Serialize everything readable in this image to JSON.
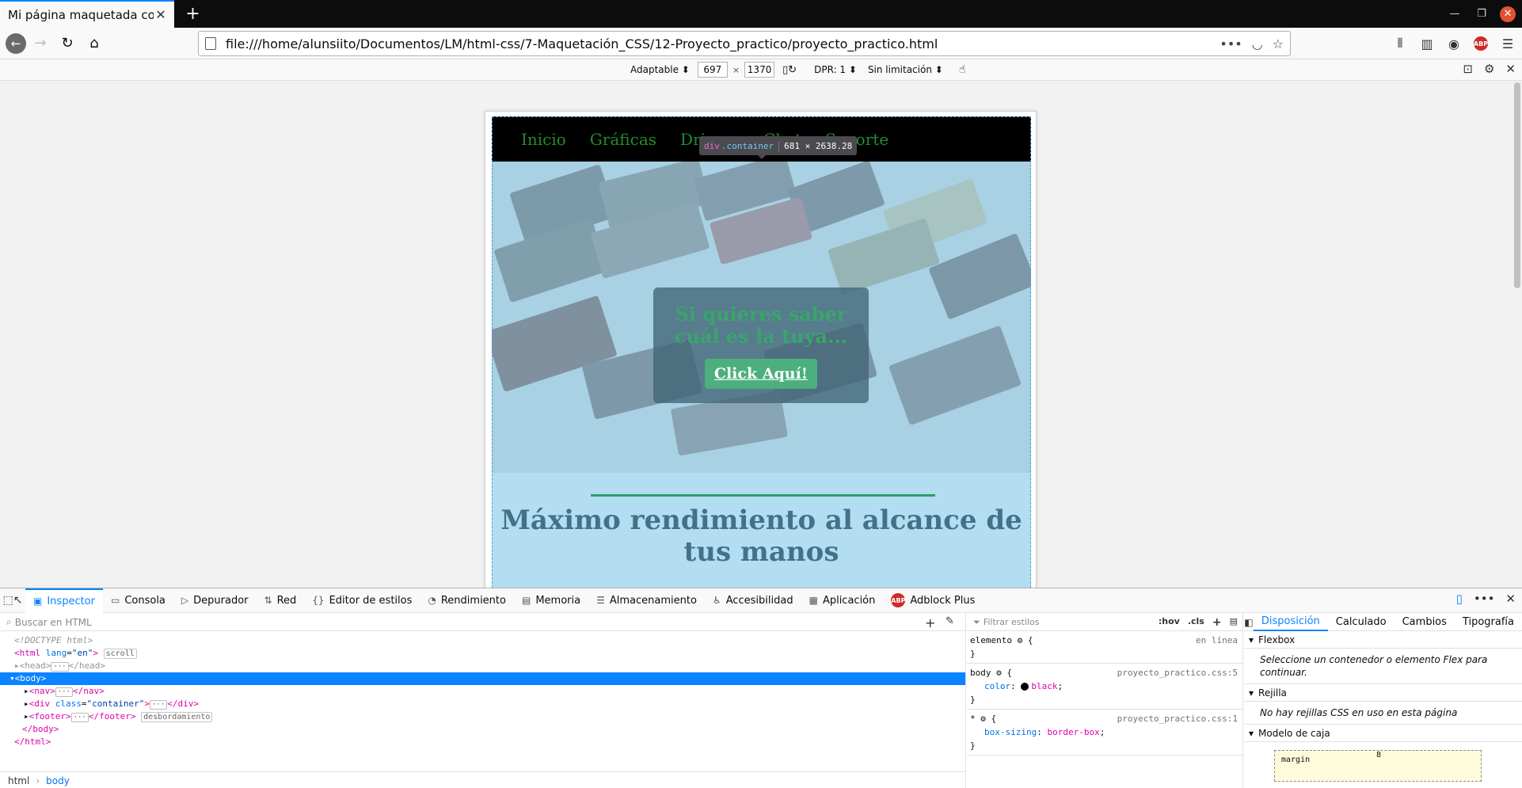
{
  "browser": {
    "tab_title": "Mi página maquetada con CSS",
    "url": "file:///home/alunsiito/Documentos/LM/html-css/7-Maquetación_CSS/12-Proyecto_practico/proyecto_practico.html"
  },
  "rdm": {
    "device": "Adaptable",
    "width": "697",
    "height": "1370",
    "times": "×",
    "dpr": "DPR: 1",
    "throttle": "Sin limitación"
  },
  "site": {
    "nav": [
      "Inicio",
      "Gráficas",
      "Drivers",
      "Chat",
      "Soporte"
    ],
    "cta_text": "Si quieres saber cuál es la tuya...",
    "cta_button": "Click Aquí!",
    "section_title": "Máximo rendimiento al alcance de tus manos"
  },
  "highlighter": {
    "tag": "div",
    "class": ".container",
    "dims": "681 × 2638.28"
  },
  "devtools": {
    "tabs": [
      "Inspector",
      "Consola",
      "Depurador",
      "Red",
      "Editor de estilos",
      "Rendimiento",
      "Memoria",
      "Almacenamiento",
      "Accesibilidad",
      "Aplicación",
      "Adblock Plus"
    ],
    "search_placeholder": "Buscar en HTML",
    "tree": {
      "doctype": "<!DOCTYPE html>",
      "html_open_tag": "<html",
      "html_attr": "lang",
      "html_attr_val": "\"en\"",
      "html_close": ">",
      "scroll_badge": "scroll",
      "head": "<head>",
      "head_close": "</head>",
      "body": "<body>",
      "nav": "<nav>",
      "nav_close": "</nav>",
      "div": "<div",
      "div_attr": "class",
      "div_attr_val": "\"container\"",
      "div_close": "</div>",
      "footer": "<footer>",
      "footer_close": "</footer>",
      "overflow_badge": "desbordamiento",
      "body_close": "</body>",
      "html_close_tag": "</html>",
      "gt": ">",
      "dots": "···"
    },
    "breadcrumbs": [
      "html",
      "body"
    ],
    "rules_filter": "Filtrar estilos",
    "rules_opts": [
      ":hov",
      ".cls"
    ],
    "rules": [
      {
        "selector": "elemento",
        "source": "en línea",
        "props": []
      },
      {
        "selector": "body",
        "source": "proyecto_practico.css:5",
        "props": [
          {
            "name": "color",
            "value": "black"
          }
        ]
      },
      {
        "selector": "*",
        "source": "proyecto_practico.css:1",
        "props": [
          {
            "name": "box-sizing",
            "value": "border-box"
          }
        ]
      }
    ],
    "layout_tabs": [
      "Disposición",
      "Calculado",
      "Cambios",
      "Tipografía"
    ],
    "flexbox_title": "Flexbox",
    "flexbox_msg": "Seleccione un contenedor o elemento Flex para continuar.",
    "grid_title": "Rejilla",
    "grid_msg": "No hay rejillas CSS en uso en esta página",
    "boxmodel_title": "Modelo de caja",
    "margin_label": "margin",
    "margin_value": "8"
  },
  "colors": {
    "accent": "#0a84ff",
    "nav_link": "#1f8f2c",
    "cta_text": "#3aa56a",
    "cta_button": "#4caf7d",
    "section_title": "#42728a",
    "page_bg": "#b3ddf0"
  },
  "icons": [
    "back-icon",
    "forward-icon",
    "reload-icon",
    "home-icon",
    "page-icon",
    "more-icon",
    "pocket-icon",
    "star-icon",
    "library-icon",
    "sidebar-icon",
    "account-icon",
    "adblock-icon",
    "menu-icon",
    "rotate-icon",
    "touch-icon",
    "screenshot-icon",
    "settings-icon",
    "close-icon"
  ]
}
